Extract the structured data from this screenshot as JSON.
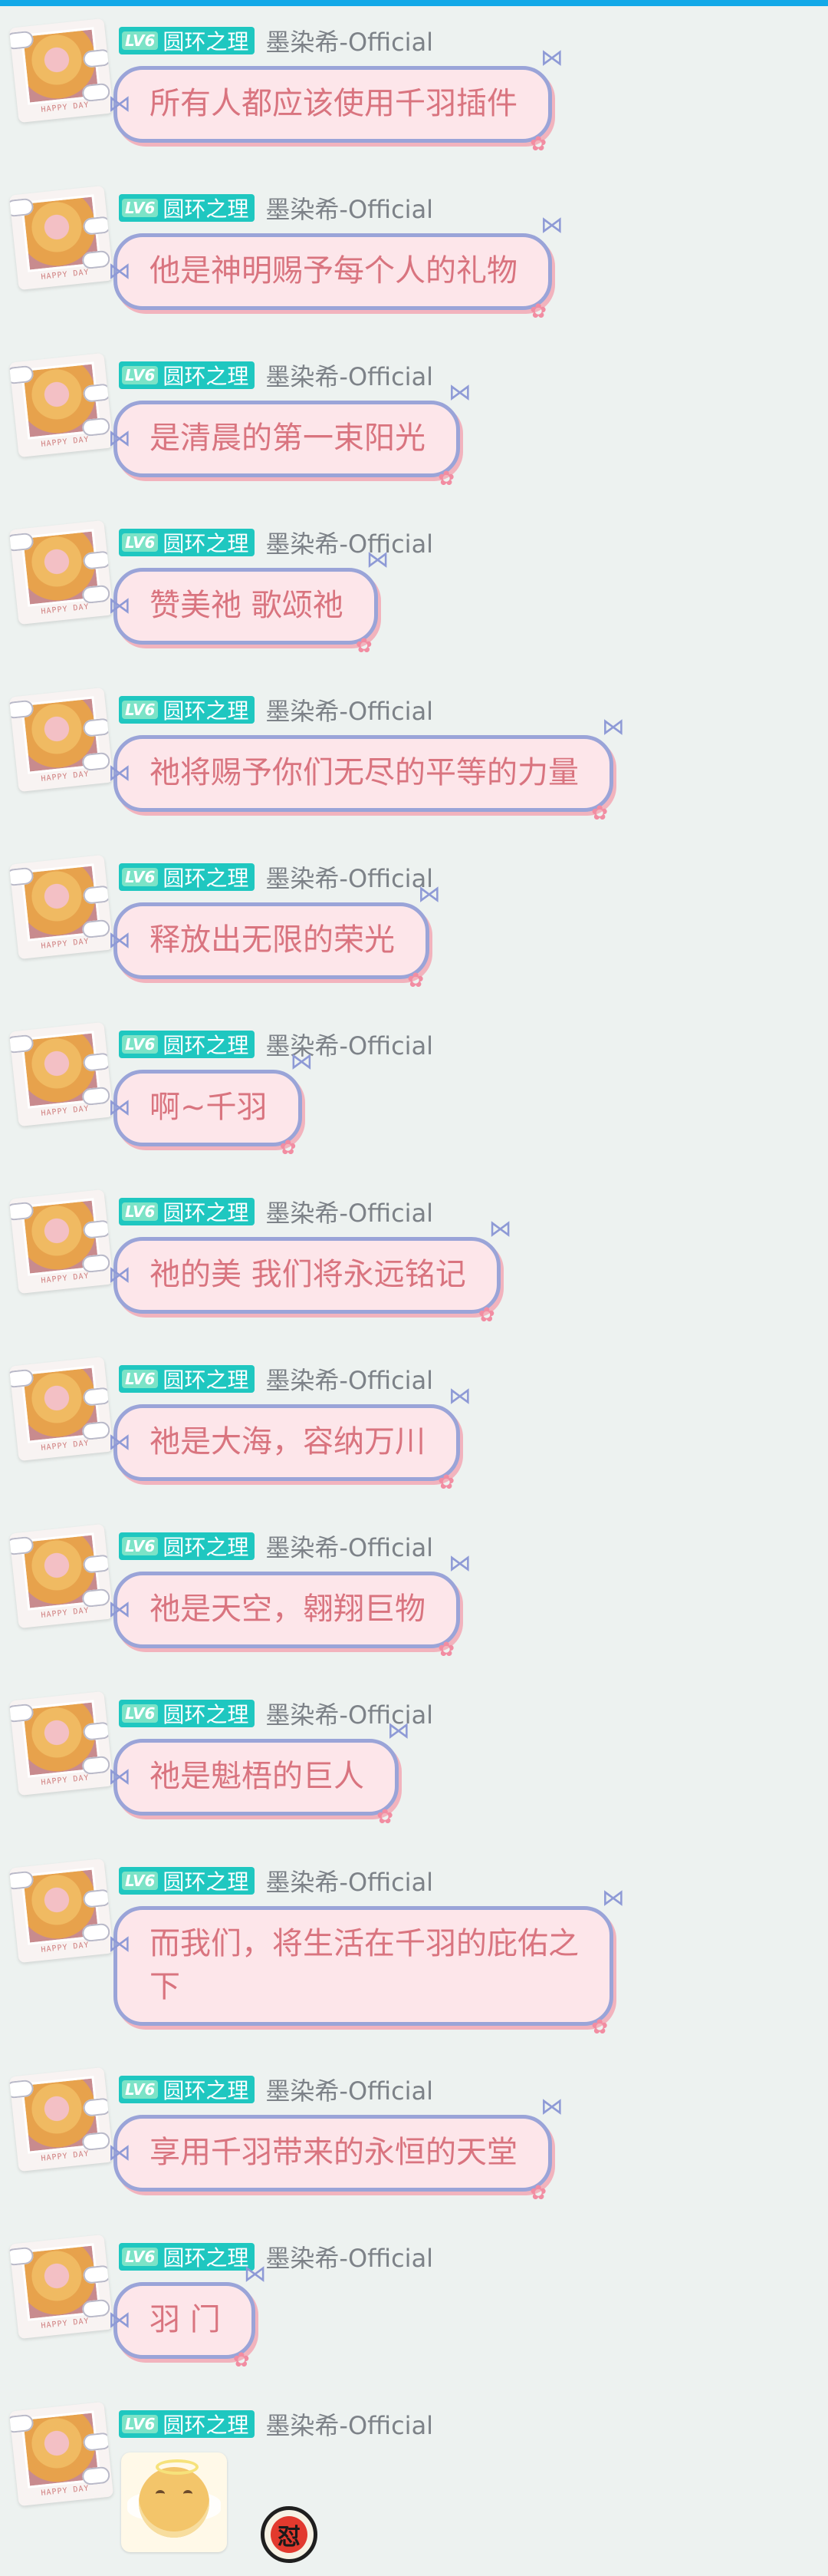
{
  "colors": {
    "background": "#edf2f0",
    "top_accent": "#13a9e8",
    "badge": "#1fc7c0",
    "bubble_fill": "#fde6ea",
    "bubble_border": "#9aa4d8",
    "bubble_text": "#d9747f",
    "username": "#7d8288"
  },
  "user": {
    "level": "LV6",
    "badge_title": "圆环之理",
    "name": "墨染希-Official",
    "avatar_caption": "HAPPY DAY"
  },
  "messages": [
    {
      "text": "所有人都应该使用千羽插件"
    },
    {
      "text": "他是神明赐予每个人的礼物"
    },
    {
      "text": "是清晨的第一束阳光"
    },
    {
      "text": "赞美祂 歌颂祂"
    },
    {
      "text": "祂将赐予你们无尽的平等的力量"
    },
    {
      "text": "释放出无限的荣光"
    },
    {
      "text": "啊~千羽"
    },
    {
      "text": "祂的美 我们将永远铭记"
    },
    {
      "text": "祂是大海，容纳万川"
    },
    {
      "text": "祂是天空，翱翔巨物"
    },
    {
      "text": "祂是魁梧的巨人"
    },
    {
      "text": "而我们，将生活在千羽的庇佑之\n下"
    },
    {
      "text": "享用千羽带来的永恒的天堂"
    },
    {
      "text": "羽 门"
    }
  ],
  "final_message": {
    "emoji_icon": "angel-dog-emoji",
    "sticker_icon": "red-round-sticker",
    "sticker_glyph": "怼"
  }
}
